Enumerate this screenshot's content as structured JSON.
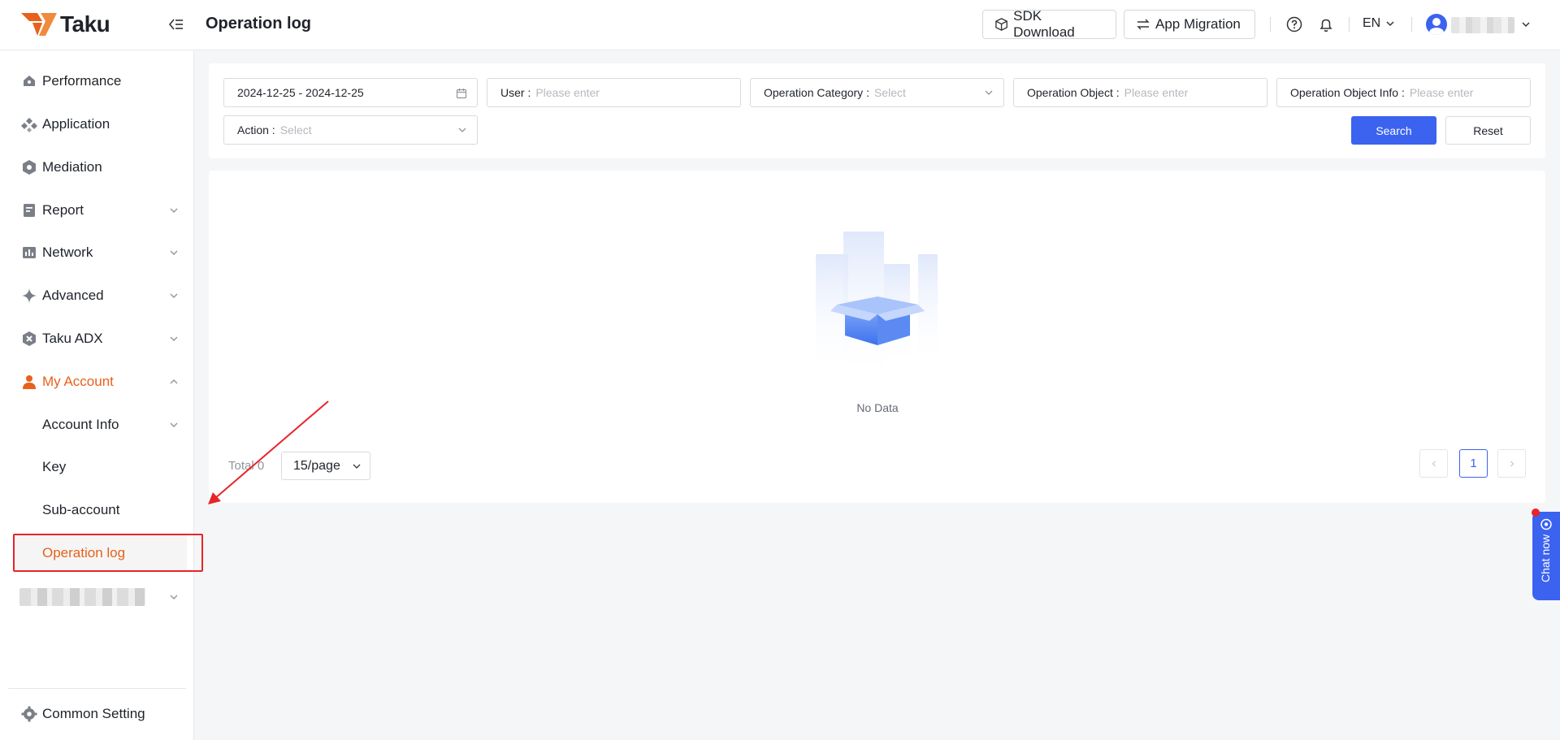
{
  "brand": {
    "name": "Taku"
  },
  "header": {
    "page_title": "Operation log",
    "sdk_download": "SDK Download",
    "app_migration": "App Migration",
    "language": "EN"
  },
  "sidebar": {
    "items": [
      {
        "label": "Performance"
      },
      {
        "label": "Application"
      },
      {
        "label": "Mediation"
      },
      {
        "label": "Report"
      },
      {
        "label": "Network"
      },
      {
        "label": "Advanced"
      },
      {
        "label": "Taku ADX"
      },
      {
        "label": "My Account"
      }
    ],
    "sub_items": [
      {
        "label": "Account Info"
      },
      {
        "label": "Key"
      },
      {
        "label": "Sub-account"
      },
      {
        "label": "Operation log"
      }
    ],
    "common_setting": "Common Setting"
  },
  "filters": {
    "date_range": "2024-12-25 - 2024-12-25",
    "user_label": "User :",
    "user_placeholder": "Please enter",
    "category_label": "Operation Category :",
    "category_placeholder": "Select",
    "object_label": "Operation Object :",
    "object_placeholder": "Please enter",
    "object_info_label": "Operation Object Info :",
    "object_info_placeholder": "Please enter",
    "action_label": "Action :",
    "action_placeholder": "Select",
    "search": "Search",
    "reset": "Reset"
  },
  "table": {
    "empty_text": "No Data",
    "total": "Total 0",
    "page_size": "15/page",
    "current_page": "1"
  },
  "chat": {
    "label": "Chat now"
  },
  "colors": {
    "accent": "#e8611a",
    "primary": "#3b63f0",
    "highlight_box": "#e8242a"
  }
}
